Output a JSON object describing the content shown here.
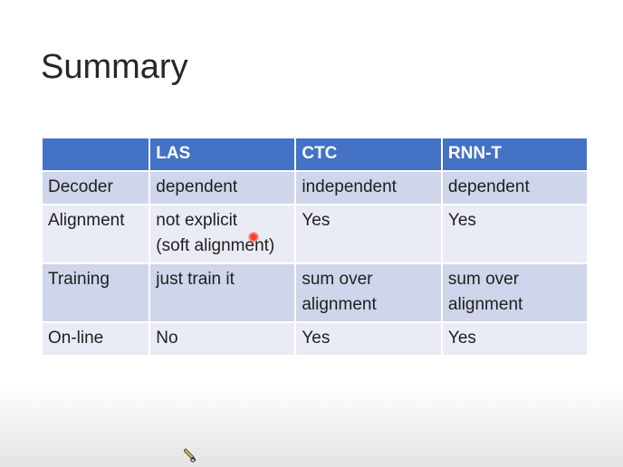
{
  "slide": {
    "title": "Summary"
  },
  "table": {
    "headers": [
      "",
      "LAS",
      "CTC",
      "RNN-T"
    ],
    "rows": [
      {
        "label": "Decoder",
        "cells": [
          "dependent",
          "independent",
          "dependent"
        ]
      },
      {
        "label": "Alignment",
        "cells": [
          "not explicit\n(soft alignment)",
          "Yes",
          "Yes"
        ]
      },
      {
        "label": "Training",
        "cells": [
          "just train it",
          "sum over\nalignment",
          "sum over\nalignment"
        ]
      },
      {
        "label": "On-line",
        "cells": [
          "No",
          "Yes",
          "Yes"
        ]
      }
    ]
  },
  "colors": {
    "header_bg": "#4472c4",
    "row_odd_bg": "#cfd5ea",
    "row_even_bg": "#e9ebf5",
    "laser_pointer": "#ff3b2f"
  },
  "icons": {
    "laser": "laser-pointer-icon",
    "pen": "pen-cursor-icon"
  }
}
